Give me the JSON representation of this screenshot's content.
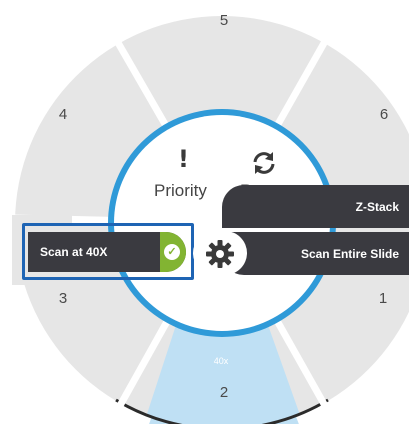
{
  "wheel": {
    "slots": [
      {
        "number": "5"
      },
      {
        "number": "6"
      },
      {
        "number": "1"
      },
      {
        "number": "2",
        "sublabel": "40x",
        "selected": true
      },
      {
        "number": "3"
      },
      {
        "number": "4"
      }
    ],
    "colors": {
      "slot_fill": "#e6e6e6",
      "selected_fill": "#bfe0f4",
      "selected_edge": "#2b2b2b",
      "ring": "#2f9ad8",
      "bar": "#3a3a40",
      "check_green": "#82b432",
      "highlight_outline": "#1e64b4"
    }
  },
  "center": {
    "priority_label": "Priority",
    "priority_icon": "exclamation-icon",
    "rotate_label": "Rotate",
    "rotate_icon": "refresh-icon"
  },
  "menu": {
    "z_stack_label": "Z-Stack",
    "scan_entire_label": "Scan Entire Slide",
    "scan_40x_label": "Scan at 40X",
    "scan_40x_checked": true,
    "settings_icon": "gear-icon"
  }
}
